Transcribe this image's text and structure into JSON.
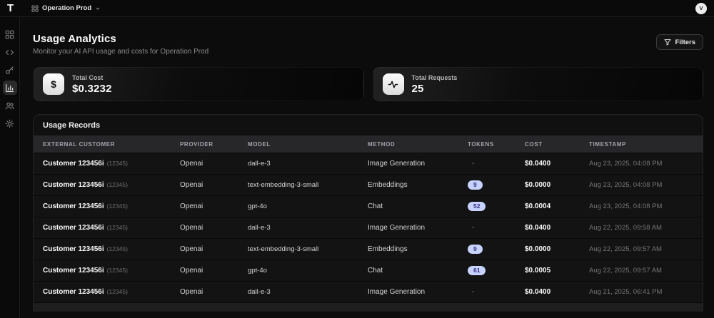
{
  "topbar": {
    "logo": "T",
    "org_name": "Operation Prod",
    "avatar_initial": "V"
  },
  "sidebar": {
    "items": [
      {
        "name": "dashboard",
        "active": false
      },
      {
        "name": "code",
        "active": false
      },
      {
        "name": "api-keys",
        "active": false
      },
      {
        "name": "analytics",
        "active": true
      },
      {
        "name": "users",
        "active": false
      },
      {
        "name": "settings",
        "active": false
      }
    ]
  },
  "header": {
    "title": "Usage Analytics",
    "subtitle": "Monitor your AI API usage and costs for Operation Prod",
    "filters_label": "Filters"
  },
  "stats": [
    {
      "icon": "dollar",
      "label": "Total Cost",
      "value": "$0.3232"
    },
    {
      "icon": "activity",
      "label": "Total Requests",
      "value": "25"
    }
  ],
  "table": {
    "title": "Usage Records",
    "columns": [
      "External Customer",
      "Provider",
      "Model",
      "Method",
      "Tokens",
      "Cost",
      "Timestamp"
    ],
    "rows": [
      {
        "customer": "Customer 123456i",
        "customer_id": "(12345)",
        "provider": "Openai",
        "model": "dall-e-3",
        "method": "Image Generation",
        "tokens": "-",
        "cost": "$0.0400",
        "timestamp": "Aug 23, 2025, 04:08 PM"
      },
      {
        "customer": "Customer 123456i",
        "customer_id": "(12345)",
        "provider": "Openai",
        "model": "text-embedding-3-small",
        "method": "Embeddings",
        "tokens": "9",
        "cost": "$0.0000",
        "timestamp": "Aug 23, 2025, 04:08 PM"
      },
      {
        "customer": "Customer 123456i",
        "customer_id": "(12345)",
        "provider": "Openai",
        "model": "gpt-4o",
        "method": "Chat",
        "tokens": "52",
        "cost": "$0.0004",
        "timestamp": "Aug 23, 2025, 04:08 PM"
      },
      {
        "customer": "Customer 123456i",
        "customer_id": "(12345)",
        "provider": "Openai",
        "model": "dall-e-3",
        "method": "Image Generation",
        "tokens": "-",
        "cost": "$0.0400",
        "timestamp": "Aug 22, 2025, 09:58 AM"
      },
      {
        "customer": "Customer 123456i",
        "customer_id": "(12345)",
        "provider": "Openai",
        "model": "text-embedding-3-small",
        "method": "Embeddings",
        "tokens": "9",
        "cost": "$0.0000",
        "timestamp": "Aug 22, 2025, 09:57 AM"
      },
      {
        "customer": "Customer 123456i",
        "customer_id": "(12345)",
        "provider": "Openai",
        "model": "gpt-4o",
        "method": "Chat",
        "tokens": "61",
        "cost": "$0.0005",
        "timestamp": "Aug 22, 2025, 09:57 AM"
      },
      {
        "customer": "Customer 123456i",
        "customer_id": "(12345)",
        "provider": "Openai",
        "model": "dall-e-3",
        "method": "Image Generation",
        "tokens": "-",
        "cost": "$0.0400",
        "timestamp": "Aug 21, 2025, 06:41 PM"
      }
    ]
  },
  "colors": {
    "badge_bg": "#c7d2fe",
    "badge_text": "#312e81",
    "table_header_bg": "#27272a",
    "background": "#0c0c0c"
  }
}
